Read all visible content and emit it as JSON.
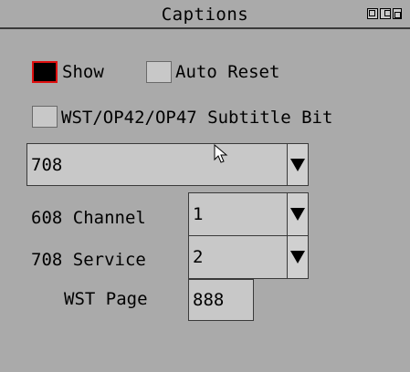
{
  "window": {
    "title": "Captions"
  },
  "options": {
    "show_label": "Show",
    "show_checked": true,
    "auto_reset_label": "Auto Reset",
    "auto_reset_checked": false,
    "subtitle_bit_label": "WST/OP42/OP47 Subtitle Bit",
    "subtitle_bit_checked": false
  },
  "caption_type": {
    "value": "708"
  },
  "channel_608": {
    "label": "608 Channel",
    "value": "1"
  },
  "service_708": {
    "label": "708 Service",
    "value": "2"
  },
  "wst_page": {
    "label": "WST Page",
    "value": "888"
  },
  "colors": {
    "accent_border": "#e01010",
    "background": "#aaaaaa",
    "control": "#c8c8c8"
  }
}
